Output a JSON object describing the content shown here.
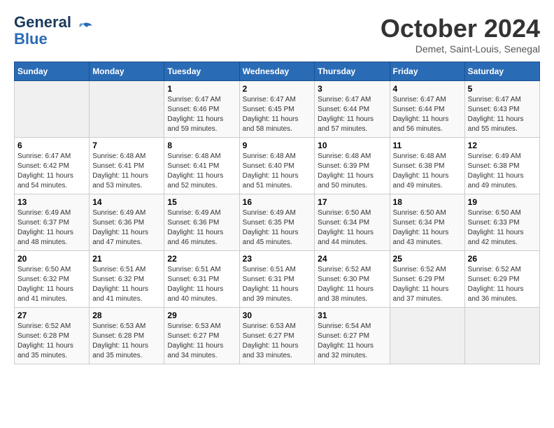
{
  "header": {
    "logo_line1": "General",
    "logo_line2": "Blue",
    "month_title": "October 2024",
    "subtitle": "Demet, Saint-Louis, Senegal"
  },
  "weekdays": [
    "Sunday",
    "Monday",
    "Tuesday",
    "Wednesday",
    "Thursday",
    "Friday",
    "Saturday"
  ],
  "weeks": [
    [
      {
        "num": "",
        "empty": true
      },
      {
        "num": "",
        "empty": true
      },
      {
        "num": "1",
        "sunrise": "6:47 AM",
        "sunset": "6:46 PM",
        "daylight": "11 hours and 59 minutes."
      },
      {
        "num": "2",
        "sunrise": "6:47 AM",
        "sunset": "6:45 PM",
        "daylight": "11 hours and 58 minutes."
      },
      {
        "num": "3",
        "sunrise": "6:47 AM",
        "sunset": "6:44 PM",
        "daylight": "11 hours and 57 minutes."
      },
      {
        "num": "4",
        "sunrise": "6:47 AM",
        "sunset": "6:44 PM",
        "daylight": "11 hours and 56 minutes."
      },
      {
        "num": "5",
        "sunrise": "6:47 AM",
        "sunset": "6:43 PM",
        "daylight": "11 hours and 55 minutes."
      }
    ],
    [
      {
        "num": "6",
        "sunrise": "6:47 AM",
        "sunset": "6:42 PM",
        "daylight": "11 hours and 54 minutes."
      },
      {
        "num": "7",
        "sunrise": "6:48 AM",
        "sunset": "6:41 PM",
        "daylight": "11 hours and 53 minutes."
      },
      {
        "num": "8",
        "sunrise": "6:48 AM",
        "sunset": "6:41 PM",
        "daylight": "11 hours and 52 minutes."
      },
      {
        "num": "9",
        "sunrise": "6:48 AM",
        "sunset": "6:40 PM",
        "daylight": "11 hours and 51 minutes."
      },
      {
        "num": "10",
        "sunrise": "6:48 AM",
        "sunset": "6:39 PM",
        "daylight": "11 hours and 50 minutes."
      },
      {
        "num": "11",
        "sunrise": "6:48 AM",
        "sunset": "6:38 PM",
        "daylight": "11 hours and 49 minutes."
      },
      {
        "num": "12",
        "sunrise": "6:49 AM",
        "sunset": "6:38 PM",
        "daylight": "11 hours and 49 minutes."
      }
    ],
    [
      {
        "num": "13",
        "sunrise": "6:49 AM",
        "sunset": "6:37 PM",
        "daylight": "11 hours and 48 minutes."
      },
      {
        "num": "14",
        "sunrise": "6:49 AM",
        "sunset": "6:36 PM",
        "daylight": "11 hours and 47 minutes."
      },
      {
        "num": "15",
        "sunrise": "6:49 AM",
        "sunset": "6:36 PM",
        "daylight": "11 hours and 46 minutes."
      },
      {
        "num": "16",
        "sunrise": "6:49 AM",
        "sunset": "6:35 PM",
        "daylight": "11 hours and 45 minutes."
      },
      {
        "num": "17",
        "sunrise": "6:50 AM",
        "sunset": "6:34 PM",
        "daylight": "11 hours and 44 minutes."
      },
      {
        "num": "18",
        "sunrise": "6:50 AM",
        "sunset": "6:34 PM",
        "daylight": "11 hours and 43 minutes."
      },
      {
        "num": "19",
        "sunrise": "6:50 AM",
        "sunset": "6:33 PM",
        "daylight": "11 hours and 42 minutes."
      }
    ],
    [
      {
        "num": "20",
        "sunrise": "6:50 AM",
        "sunset": "6:32 PM",
        "daylight": "11 hours and 41 minutes."
      },
      {
        "num": "21",
        "sunrise": "6:51 AM",
        "sunset": "6:32 PM",
        "daylight": "11 hours and 41 minutes."
      },
      {
        "num": "22",
        "sunrise": "6:51 AM",
        "sunset": "6:31 PM",
        "daylight": "11 hours and 40 minutes."
      },
      {
        "num": "23",
        "sunrise": "6:51 AM",
        "sunset": "6:31 PM",
        "daylight": "11 hours and 39 minutes."
      },
      {
        "num": "24",
        "sunrise": "6:52 AM",
        "sunset": "6:30 PM",
        "daylight": "11 hours and 38 minutes."
      },
      {
        "num": "25",
        "sunrise": "6:52 AM",
        "sunset": "6:29 PM",
        "daylight": "11 hours and 37 minutes."
      },
      {
        "num": "26",
        "sunrise": "6:52 AM",
        "sunset": "6:29 PM",
        "daylight": "11 hours and 36 minutes."
      }
    ],
    [
      {
        "num": "27",
        "sunrise": "6:52 AM",
        "sunset": "6:28 PM",
        "daylight": "11 hours and 35 minutes."
      },
      {
        "num": "28",
        "sunrise": "6:53 AM",
        "sunset": "6:28 PM",
        "daylight": "11 hours and 35 minutes."
      },
      {
        "num": "29",
        "sunrise": "6:53 AM",
        "sunset": "6:27 PM",
        "daylight": "11 hours and 34 minutes."
      },
      {
        "num": "30",
        "sunrise": "6:53 AM",
        "sunset": "6:27 PM",
        "daylight": "11 hours and 33 minutes."
      },
      {
        "num": "31",
        "sunrise": "6:54 AM",
        "sunset": "6:27 PM",
        "daylight": "11 hours and 32 minutes."
      },
      {
        "num": "",
        "empty": true
      },
      {
        "num": "",
        "empty": true
      }
    ]
  ]
}
